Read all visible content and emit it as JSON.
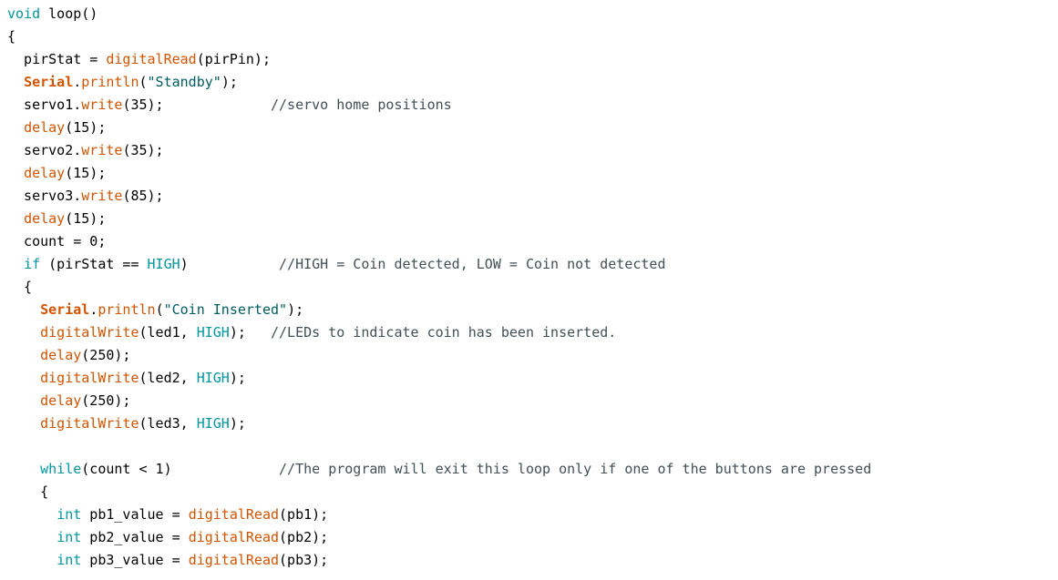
{
  "colors": {
    "plain": "#000000",
    "keyword": "#00979c",
    "function": "#d35400",
    "class": "#d35400",
    "constant": "#00979c",
    "string": "#005c5f",
    "comment": "#434f54",
    "background": "#ffffff"
  },
  "lines": [
    [
      {
        "t": "keyword",
        "v": "void"
      },
      {
        "t": "plain",
        "v": " loop()"
      }
    ],
    [
      {
        "t": "plain",
        "v": "{"
      }
    ],
    [
      {
        "t": "plain",
        "v": "  pirStat = "
      },
      {
        "t": "func",
        "v": "digitalRead"
      },
      {
        "t": "plain",
        "v": "(pirPin);"
      }
    ],
    [
      {
        "t": "plain",
        "v": "  "
      },
      {
        "t": "class",
        "v": "Serial"
      },
      {
        "t": "plain",
        "v": "."
      },
      {
        "t": "func",
        "v": "println"
      },
      {
        "t": "plain",
        "v": "("
      },
      {
        "t": "string",
        "v": "\"Standby\""
      },
      {
        "t": "plain",
        "v": ");"
      }
    ],
    [
      {
        "t": "plain",
        "v": "  servo1."
      },
      {
        "t": "func",
        "v": "write"
      },
      {
        "t": "plain",
        "v": "(35);             "
      },
      {
        "t": "comment",
        "v": "//servo home positions"
      }
    ],
    [
      {
        "t": "plain",
        "v": "  "
      },
      {
        "t": "func",
        "v": "delay"
      },
      {
        "t": "plain",
        "v": "(15);"
      }
    ],
    [
      {
        "t": "plain",
        "v": "  servo2."
      },
      {
        "t": "func",
        "v": "write"
      },
      {
        "t": "plain",
        "v": "(35);"
      }
    ],
    [
      {
        "t": "plain",
        "v": "  "
      },
      {
        "t": "func",
        "v": "delay"
      },
      {
        "t": "plain",
        "v": "(15);"
      }
    ],
    [
      {
        "t": "plain",
        "v": "  servo3."
      },
      {
        "t": "func",
        "v": "write"
      },
      {
        "t": "plain",
        "v": "(85);"
      }
    ],
    [
      {
        "t": "plain",
        "v": "  "
      },
      {
        "t": "func",
        "v": "delay"
      },
      {
        "t": "plain",
        "v": "(15);"
      }
    ],
    [
      {
        "t": "plain",
        "v": "  count = 0;"
      }
    ],
    [
      {
        "t": "plain",
        "v": "  "
      },
      {
        "t": "keyword",
        "v": "if"
      },
      {
        "t": "plain",
        "v": " (pirStat == "
      },
      {
        "t": "const",
        "v": "HIGH"
      },
      {
        "t": "plain",
        "v": ")           "
      },
      {
        "t": "comment",
        "v": "//HIGH = Coin detected, LOW = Coin not detected"
      }
    ],
    [
      {
        "t": "plain",
        "v": "  {"
      }
    ],
    [
      {
        "t": "plain",
        "v": "    "
      },
      {
        "t": "class",
        "v": "Serial"
      },
      {
        "t": "plain",
        "v": "."
      },
      {
        "t": "func",
        "v": "println"
      },
      {
        "t": "plain",
        "v": "("
      },
      {
        "t": "string",
        "v": "\"Coin Inserted\""
      },
      {
        "t": "plain",
        "v": ");"
      }
    ],
    [
      {
        "t": "plain",
        "v": "    "
      },
      {
        "t": "func",
        "v": "digitalWrite"
      },
      {
        "t": "plain",
        "v": "(led1, "
      },
      {
        "t": "const",
        "v": "HIGH"
      },
      {
        "t": "plain",
        "v": ");   "
      },
      {
        "t": "comment",
        "v": "//LEDs to indicate coin has been inserted."
      }
    ],
    [
      {
        "t": "plain",
        "v": "    "
      },
      {
        "t": "func",
        "v": "delay"
      },
      {
        "t": "plain",
        "v": "(250);"
      }
    ],
    [
      {
        "t": "plain",
        "v": "    "
      },
      {
        "t": "func",
        "v": "digitalWrite"
      },
      {
        "t": "plain",
        "v": "(led2, "
      },
      {
        "t": "const",
        "v": "HIGH"
      },
      {
        "t": "plain",
        "v": ");"
      }
    ],
    [
      {
        "t": "plain",
        "v": "    "
      },
      {
        "t": "func",
        "v": "delay"
      },
      {
        "t": "plain",
        "v": "(250);"
      }
    ],
    [
      {
        "t": "plain",
        "v": "    "
      },
      {
        "t": "func",
        "v": "digitalWrite"
      },
      {
        "t": "plain",
        "v": "(led3, "
      },
      {
        "t": "const",
        "v": "HIGH"
      },
      {
        "t": "plain",
        "v": ");"
      }
    ],
    [],
    [
      {
        "t": "plain",
        "v": "    "
      },
      {
        "t": "keyword",
        "v": "while"
      },
      {
        "t": "plain",
        "v": "(count < 1)             "
      },
      {
        "t": "comment",
        "v": "//The program will exit this loop only if one of the buttons are pressed"
      }
    ],
    [
      {
        "t": "plain",
        "v": "    {"
      }
    ],
    [
      {
        "t": "plain",
        "v": "      "
      },
      {
        "t": "keyword",
        "v": "int"
      },
      {
        "t": "plain",
        "v": " pb1_value = "
      },
      {
        "t": "func",
        "v": "digitalRead"
      },
      {
        "t": "plain",
        "v": "(pb1);"
      }
    ],
    [
      {
        "t": "plain",
        "v": "      "
      },
      {
        "t": "keyword",
        "v": "int"
      },
      {
        "t": "plain",
        "v": " pb2_value = "
      },
      {
        "t": "func",
        "v": "digitalRead"
      },
      {
        "t": "plain",
        "v": "(pb2);"
      }
    ],
    [
      {
        "t": "plain",
        "v": "      "
      },
      {
        "t": "keyword",
        "v": "int"
      },
      {
        "t": "plain",
        "v": " pb3_value = "
      },
      {
        "t": "func",
        "v": "digitalRead"
      },
      {
        "t": "plain",
        "v": "(pb3);"
      }
    ]
  ]
}
